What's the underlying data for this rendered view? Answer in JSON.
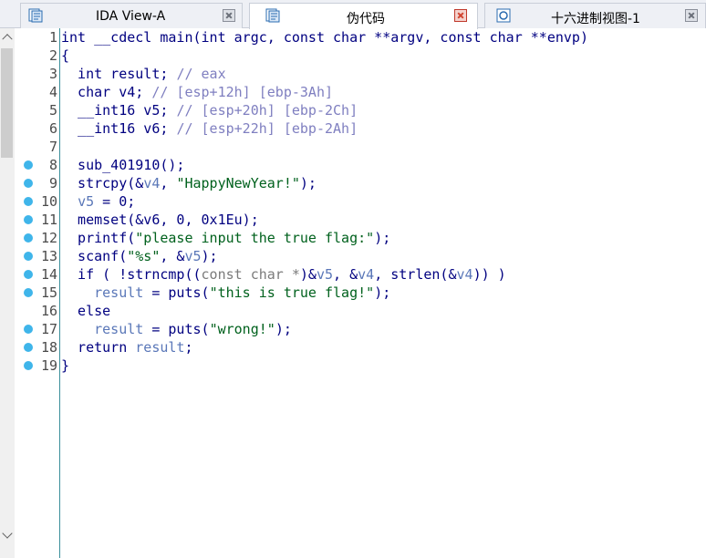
{
  "tabs": [
    {
      "label": "IDA View-A",
      "active": false,
      "close_color": "#8a8f99"
    },
    {
      "label": "伪代码",
      "active": true,
      "close_color": "#d14430"
    },
    {
      "label": "十六进制视图-1",
      "active": false,
      "close_color": "#8a8f99"
    }
  ],
  "line_numbers": [
    "1",
    "2",
    "3",
    "4",
    "5",
    "6",
    "7",
    "8",
    "9",
    "10",
    "11",
    "12",
    "13",
    "14",
    "15",
    "16",
    "17",
    "18",
    "19"
  ],
  "breakpoint_lines": [
    "8",
    "9",
    "10",
    "11",
    "12",
    "13",
    "14",
    "15",
    "17",
    "18",
    "19"
  ],
  "code": {
    "l1": "int __cdecl main(int argc, const char **argv, const char **envp)",
    "l2": "{",
    "l3_a": "  int result; ",
    "l3_b": "// eax",
    "l4_a": "  char v4; ",
    "l4_b": "// [esp+12h] [ebp-3Ah]",
    "l5_a": "  __int16 v5; ",
    "l5_b": "// [esp+20h] [ebp-2Ch]",
    "l6_a": "  __int16 v6; ",
    "l6_b": "// [esp+22h] [ebp-2Ah]",
    "l8": "  sub_401910();",
    "l9_a": "  strcpy(&",
    "l9_b": "v4",
    "l9_c": ", ",
    "l9_d": "\"HappyNewYear!\"",
    "l9_e": ");",
    "l10_a": "  ",
    "l10_b": "v5",
    "l10_c": " = 0;",
    "l11": "  memset(&v6, 0, 0x1Eu);",
    "l12_a": "  printf(",
    "l12_b": "\"please input the true flag:\"",
    "l12_c": ");",
    "l13_a": "  scanf(",
    "l13_b": "\"%s\"",
    "l13_c": ", &",
    "l13_d": "v5",
    "l13_e": ");",
    "l14_a": "  if ( !strncmp((",
    "l14_b": "const char *",
    "l14_c": ")&",
    "l14_d": "v5",
    "l14_e": ", &",
    "l14_f": "v4",
    "l14_g": ", strlen(&",
    "l14_h": "v4",
    "l14_i": ")) )",
    "l15_a": "    ",
    "l15_b": "result",
    "l15_c": " = puts(",
    "l15_d": "\"this is true flag!\"",
    "l15_e": ");",
    "l16": "  else",
    "l17_a": "    ",
    "l17_b": "result",
    "l17_c": " = puts(",
    "l17_d": "\"wrong!\"",
    "l17_e": ");",
    "l18_a": "  return ",
    "l18_b": "result",
    "l18_c": ";",
    "l19": "}"
  }
}
